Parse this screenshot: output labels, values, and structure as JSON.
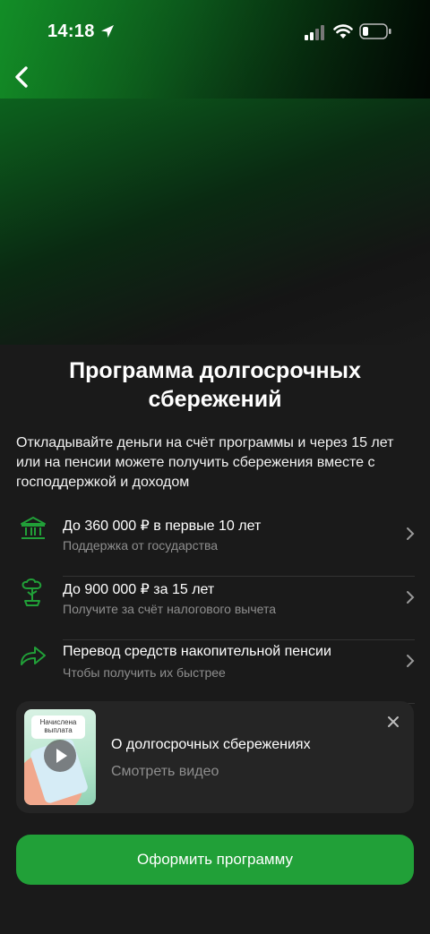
{
  "status_bar": {
    "time": "14:18"
  },
  "nav": {
    "back_icon": "chevron-left-icon"
  },
  "main": {
    "title": "Программа долгосрочных сбережений",
    "description": "Откладывайте деньги на счёт программы и через 15 лет или на пенсии можете получить сбережения вместе с господдержкой и доходом",
    "features": [
      {
        "icon": "bank-icon",
        "title": "До 360 000 ₽ в первые 10 лет",
        "subtitle": "Поддержка от государства"
      },
      {
        "icon": "money-tree-icon",
        "title": "До 900 000 ₽ за 15 лет",
        "subtitle": "Получите за счёт налогового вычета"
      },
      {
        "icon": "transfer-arrow-icon",
        "title": "Перевод средств накопительной пенсии",
        "subtitle": "Чтобы получить их быстрее"
      }
    ]
  },
  "video_card": {
    "thumbnail_caption": "Начислена выплата",
    "title": "О долгосрочных сбережениях",
    "subtitle": "Смотреть видео"
  },
  "cta": {
    "label": "Оформить программу"
  },
  "colors": {
    "accent": "#21a038",
    "background": "#1a1a1a",
    "card": "#252525",
    "secondary_text": "#8e8e8e"
  }
}
